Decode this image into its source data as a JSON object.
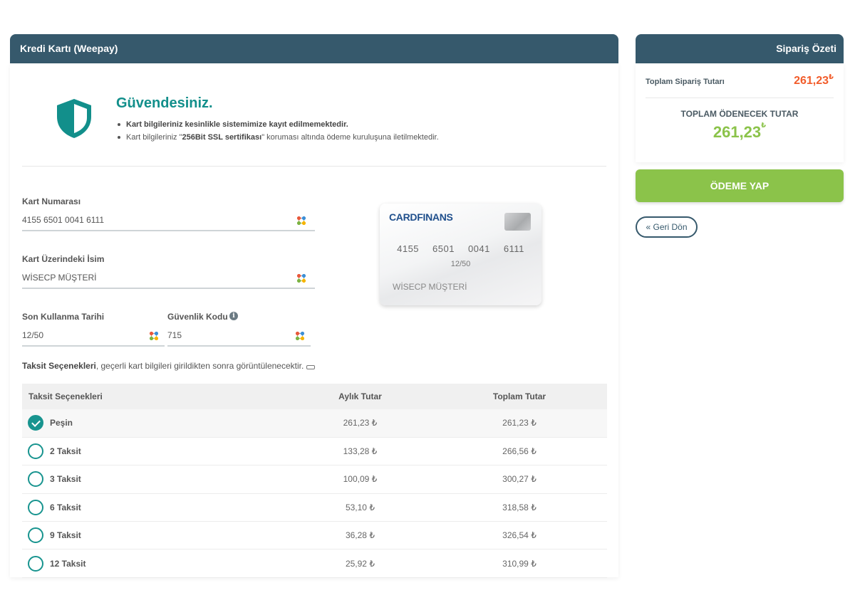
{
  "payment_panel": {
    "title": "Kredi Kartı (Weepay)",
    "secure_title": "Güvendesiniz.",
    "secure_line1": "Kart bilgileriniz kesinlikle sistemimize kayıt edilmemektedir.",
    "secure_line2_prefix": "Kart bilgileriniz \"",
    "secure_line2_bold": "256Bit SSL sertifikası",
    "secure_line2_suffix": "\" koruması altında ödeme kuruluşuna iletilmektedir."
  },
  "form": {
    "card_number_label": "Kart Numarası",
    "card_number_value": "4155 6501 0041 6111",
    "name_label": "Kart Üzerindeki İsim",
    "name_value": "WİSECP MÜŞTERİ",
    "expiry_label": "Son Kullanma Tarihi",
    "expiry_value": "12/50",
    "cvc_label": "Güvenlik Kodu",
    "cvc_value": "715"
  },
  "card_preview": {
    "brand": "CARDFINANS",
    "number_groups": [
      "4155",
      "6501",
      "0041",
      "6111"
    ],
    "expiry": "12/50",
    "holder": "WİSECP MÜŞTERİ"
  },
  "installments": {
    "note_bold": "Taksit Seçenekleri",
    "note_rest": ", geçerli kart bilgileri girildikten sonra görüntülenecektir.",
    "headers": [
      "Taksit Seçenekleri",
      "Aylık Tutar",
      "Toplam Tutar"
    ],
    "rows": [
      {
        "label": "Peşin",
        "monthly": "261,23 ₺",
        "total": "261,23 ₺",
        "selected": true
      },
      {
        "label": "2 Taksit",
        "monthly": "133,28 ₺",
        "total": "266,56 ₺",
        "selected": false
      },
      {
        "label": "3 Taksit",
        "monthly": "100,09 ₺",
        "total": "300,27 ₺",
        "selected": false
      },
      {
        "label": "6 Taksit",
        "monthly": "53,10 ₺",
        "total": "318,58 ₺",
        "selected": false
      },
      {
        "label": "9 Taksit",
        "monthly": "36,28 ₺",
        "total": "326,54 ₺",
        "selected": false
      },
      {
        "label": "12 Taksit",
        "monthly": "25,92 ₺",
        "total": "310,99 ₺",
        "selected": false
      }
    ]
  },
  "summary": {
    "title": "Sipariş Özeti",
    "total_label": "Toplam Sipariş Tutarı",
    "total_value": "261,23",
    "payable_label": "TOPLAM ÖDENECEK TUTAR",
    "payable_value": "261,23",
    "currency": "₺",
    "pay_button": "ÖDEME YAP",
    "back_button": "Geri Dön",
    "back_icon": "«"
  },
  "colors": {
    "header": "#36596c",
    "accent": "#128f8b",
    "pay": "#8bc34a",
    "order_total": "#f25c2a"
  }
}
